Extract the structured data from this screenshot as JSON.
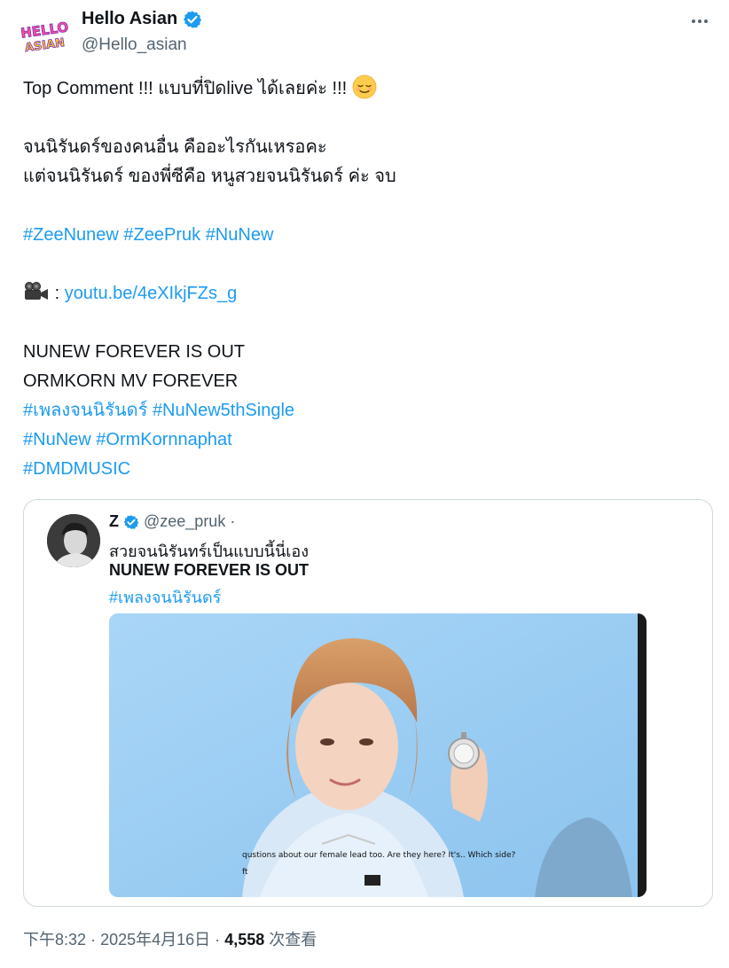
{
  "author": {
    "display_name": "Hello Asian",
    "handle": "@Hello_asian",
    "logo_text_top": "HELLO",
    "logo_text_bottom": "ASIAN"
  },
  "tweet": {
    "line1": "Top Comment !!! แบบที่ปิดlive ได้เลยค่ะ !!!",
    "line2": "จนนิรันดร์ของคนอื่น คืออะไรกันเหรอคะ",
    "line3": "แต่จนนิรันดร์ ของพี่ซีคือ หนูสวยจนนิรันดร์ ค่ะ จบ",
    "hashtags1": [
      "#ZeeNunew",
      "#ZeePruk",
      "#NuNew"
    ],
    "video_prefix": ":",
    "video_link": "youtu.be/4eXIkjFZs_g",
    "line4": "NUNEW FOREVER IS OUT",
    "line5": "ORMKORN MV FOREVER",
    "hashtags2": [
      "#เพลงจนนิรันดร์",
      "#NuNew5thSingle"
    ],
    "hashtags3": [
      "#NuNew",
      "#OrmKornnaphat"
    ],
    "hashtags4": [
      "#DMDMUSIC"
    ]
  },
  "quote": {
    "name": "Z",
    "handle": "@zee_pruk",
    "dot": "·",
    "line1": "สวยจนนิรันทร์เป็นแบบนี้นี่เอง",
    "line2": "NUNEW FOREVER IS OUT",
    "hashtag": "#เพลงจนนิรันดร์",
    "subtitle": "qustions about our female lead too. Are they here? It's.. Which side?",
    "subtitle2": "ft"
  },
  "meta": {
    "time": "下午8:32",
    "sep": "·",
    "date": "2025年4月16日",
    "views": "4,558",
    "views_label": "次查看"
  },
  "colors": {
    "link": "#1d9bf0",
    "verified": "#1d9bf0",
    "muted": "#536471"
  }
}
